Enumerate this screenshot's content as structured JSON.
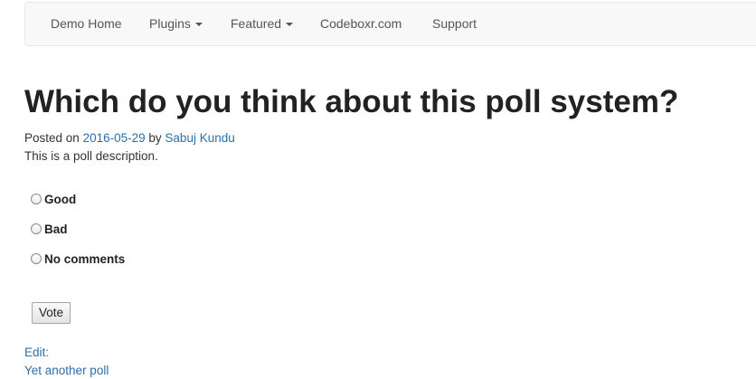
{
  "nav": {
    "items": [
      {
        "label": "Demo Home",
        "dropdown": false
      },
      {
        "label": "Plugins",
        "dropdown": true
      },
      {
        "label": "Featured",
        "dropdown": true
      },
      {
        "label": "Codeboxr.com",
        "dropdown": false
      },
      {
        "label": "Support",
        "dropdown": false
      }
    ]
  },
  "post": {
    "title": "Which do you think about this poll system?",
    "posted_on_prefix": "Posted on",
    "date": "2016-05-29",
    "by_word": "by",
    "author": "Sabuj Kundu",
    "description": "This is a poll description."
  },
  "poll": {
    "options": [
      {
        "label": "Good",
        "selected": false
      },
      {
        "label": "Bad",
        "selected": false
      },
      {
        "label": "No comments",
        "selected": false
      }
    ],
    "vote_label": "Vote"
  },
  "links": {
    "edit": "Edit:",
    "next_poll": "Yet another poll"
  },
  "colors": {
    "link": "#2a6fb0",
    "navbar_bg": "#f8f8f8",
    "text": "#333333"
  }
}
